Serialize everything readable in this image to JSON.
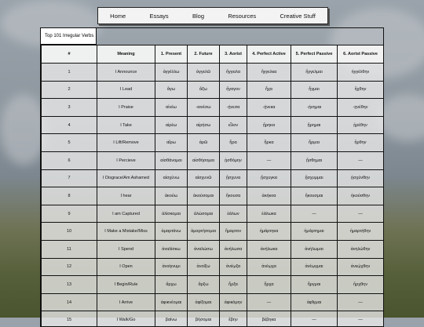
{
  "nav": [
    "Home",
    "Essays",
    "Blog",
    "Resources",
    "Creative Stuff"
  ],
  "caption": "Top 101 Irregular Verbs",
  "headers": [
    "#",
    "Meaning",
    "1. Present",
    "2. Future",
    "3. Aorist",
    "4. Perfect Active",
    "5. Perfect Passive",
    "6. Aorist Passive"
  ],
  "rows": [
    [
      "1",
      "I Announce",
      "ἀγγέλλω",
      "ἀγγελῶ",
      "ἤγγειλα",
      "ἤγγελκα",
      "ἤγγελμαι",
      "ἠγγέλθην"
    ],
    [
      "2",
      "I Lead",
      "ἄγω",
      "ἄξω",
      "ἤγαγον",
      "ἦχα",
      "ἦγμαι",
      "ἤχθην"
    ],
    [
      "3",
      "I Praise",
      "αἰνέω",
      "-αινέσω",
      "-ῄνεσα",
      "-ῄνεκα",
      "-ῄνημαι",
      "-ῃνέθην"
    ],
    [
      "4",
      "I Take",
      "αἱρέω",
      "αἱρήσω",
      "εἷλον",
      "ᾕρηκα",
      "ᾕρημαι",
      "ᾑρέθην"
    ],
    [
      "5",
      "I Lift/Remove",
      "αἴρω",
      "ἀρῶ",
      "ἦρα",
      "ἦρκα",
      "ἦρμαι",
      "ἤρθην"
    ],
    [
      "6",
      "I Percieve",
      "αἰσθάνομαι",
      "αἰσθήσομαι",
      "ᾐσθόμην",
      "—",
      "ᾔσθημαι",
      "—"
    ],
    [
      "7",
      "I Disgrace/Am Ashamed",
      "αἰσχύνω",
      "αἰσχυνῶ",
      "ᾔσχυνα",
      "ᾔσχυγκα",
      "ᾔσχυμμαι",
      "ᾐσχύνθην"
    ],
    [
      "8",
      "I hear",
      "ἀκούω",
      "ἀκούσομαι",
      "ἤκουσα",
      "ἀκήκοα",
      "ἤκουσμαι",
      "ἠκούσθην"
    ],
    [
      "9",
      "I am Captured",
      "ἁλίσκομαι",
      "ἁλώσομαι",
      "ἑάλων",
      "ἑάλωκα",
      "—",
      "—"
    ],
    [
      "10",
      "I Make a Mistake/Miss",
      "ἁμαρτάνω",
      "ἁμαρτήσομαι",
      "ἥμαρτον",
      "ἡμάρτηκα",
      "ἡμάρτημαι",
      "ἡμαρτήθην"
    ],
    [
      "11",
      "I Spend",
      "ἀναλίσκω",
      "ἀναλώσω",
      "ἀνήλωσα",
      "ἀνήλωκα",
      "ἀνήλωμαι",
      "ἀνηλώθην"
    ],
    [
      "12",
      "I Open",
      "ἀνοίγνυμι",
      "ἀνοίξω",
      "ἀνέῳξα",
      "ἀνέῳχα",
      "ἀνέῳγμαι",
      "ἀνεῴχθην"
    ],
    [
      "13",
      "I Begin/Rule",
      "ἄρχω",
      "ἄρξω",
      "ἦρξα",
      "ἦρχα",
      "ἦργμαι",
      "ἤρχθην"
    ],
    [
      "14",
      "I Arrive",
      "ἀφικνέομαι",
      "ἀφίξομαι",
      "ἀφικόμην",
      "—",
      "ἀφῖγμαι",
      "—"
    ],
    [
      "15",
      "I Walk/Go",
      "βαίνω",
      "βήσομαι",
      "ἔβην",
      "βέβηκα",
      "—",
      "—"
    ]
  ]
}
